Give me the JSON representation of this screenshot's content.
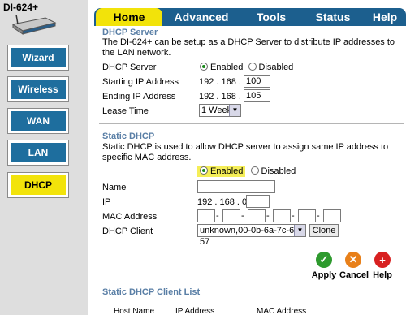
{
  "model": "DI-624+",
  "nav": [
    "Wizard",
    "Wireless",
    "WAN",
    "LAN",
    "DHCP"
  ],
  "tabs": [
    "Home",
    "Advanced",
    "Tools",
    "Status",
    "Help"
  ],
  "dhcp_server": {
    "title": "DHCP Server",
    "desc": "The DI-624+ can be setup as a DHCP Server to distribute IP addresses to the LAN network.",
    "server_label": "DHCP Server",
    "enabled": "Enabled",
    "disabled": "Disabled",
    "start_label": "Starting IP Address",
    "start_prefix": "192 . 168 . 0 .",
    "start_value": "100",
    "end_label": "Ending IP Address",
    "end_prefix": "192 . 168 . 0 .",
    "end_value": "105",
    "lease_label": "Lease Time",
    "lease_value": "1 Week"
  },
  "static_dhcp": {
    "title": "Static DHCP",
    "desc": "Static DHCP is used to allow DHCP server to assign same IP address to specific MAC address.",
    "enabled": "Enabled",
    "disabled": "Disabled",
    "name_label": "Name",
    "ip_label": "IP",
    "ip_prefix": "192 . 168 . 0 .",
    "mac_label": "MAC Address",
    "client_label": "DHCP Client",
    "client_value": "unknown,00-0b-6a-7c-65-57",
    "clone_label": "Clone"
  },
  "actions": {
    "apply": "Apply",
    "cancel": "Cancel",
    "help": "Help"
  },
  "client_list": {
    "title": "Static DHCP Client List",
    "columns": [
      "Host Name",
      "IP Address",
      "MAC Address"
    ]
  },
  "colors": {
    "nav_blue": "#1e6e9e",
    "active_yellow": "#f2e30a",
    "tab_blue": "#1c5f8e",
    "section_title": "#5a7fa6"
  }
}
